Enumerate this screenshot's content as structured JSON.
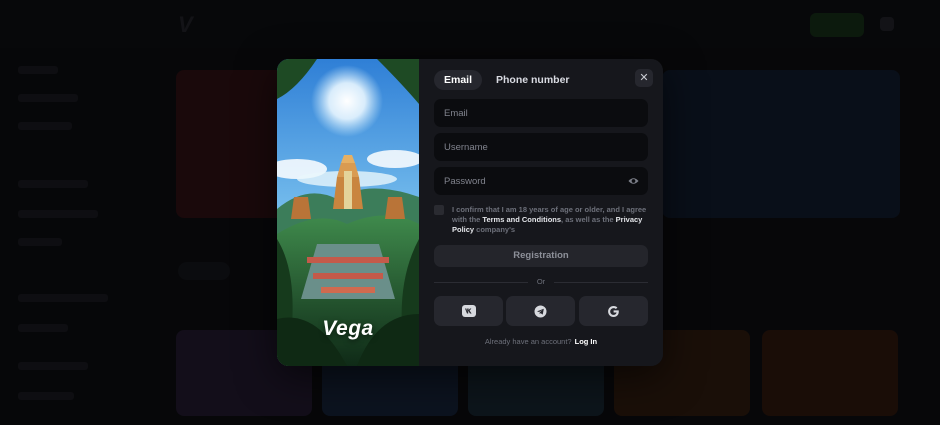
{
  "brand": {
    "logo_text": "Vega"
  },
  "tabs": [
    {
      "label": "Email",
      "active": true
    },
    {
      "label": "Phone number",
      "active": false
    }
  ],
  "fields": {
    "email": {
      "placeholder": "Email",
      "value": ""
    },
    "username": {
      "placeholder": "Username",
      "value": ""
    },
    "password": {
      "placeholder": "Password",
      "value": ""
    }
  },
  "consent": {
    "prefix": "I confirm that I am 18 years of age or older, and I agree with the ",
    "terms_link": "Terms and Conditions",
    "middle": ", as well as the ",
    "privacy_link": "Privacy Policy",
    "suffix": " company's"
  },
  "register_label": "Registration",
  "divider_label": "Or",
  "social": [
    {
      "name": "vk-icon"
    },
    {
      "name": "telegram-icon"
    },
    {
      "name": "google-icon"
    }
  ],
  "footer": {
    "prompt": "Already have an account?",
    "login_label": "Log In"
  },
  "colors": {
    "modal_bg": "#16171c",
    "field_bg": "#0b0c0f",
    "accent": "#ffffff"
  }
}
